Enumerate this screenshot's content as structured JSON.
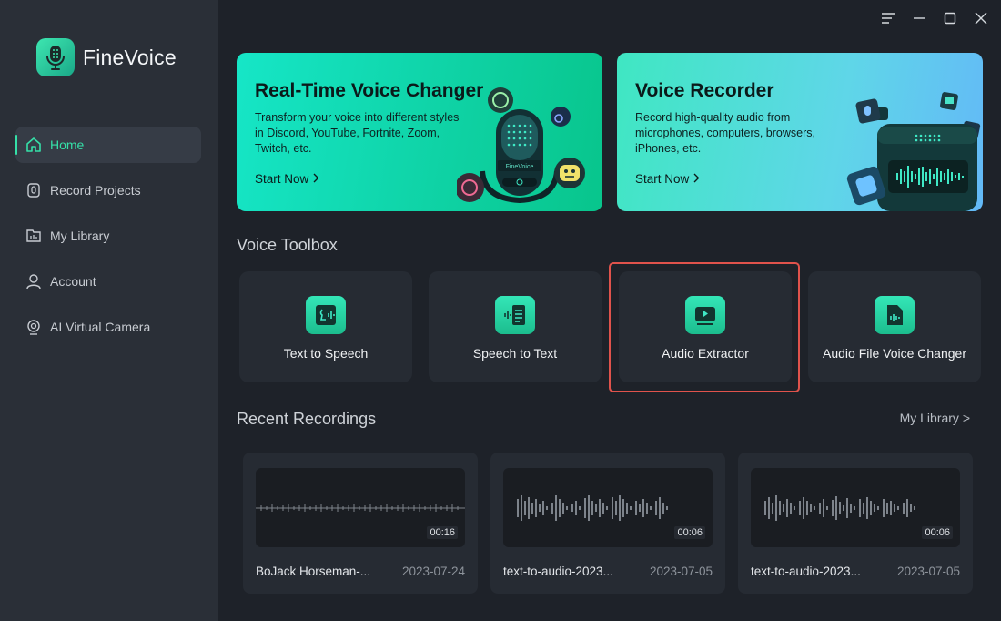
{
  "app": {
    "name": "FineVoice"
  },
  "sidebar": {
    "items": [
      {
        "label": "Home",
        "icon": "home-icon",
        "active": true
      },
      {
        "label": "Record Projects",
        "icon": "record-projects-icon"
      },
      {
        "label": "My Library",
        "icon": "library-icon"
      },
      {
        "label": "Account",
        "icon": "account-icon"
      },
      {
        "label": "AI Virtual Camera",
        "icon": "camera-icon"
      }
    ]
  },
  "window_controls": [
    "menu-icon",
    "minimize-icon",
    "maximize-icon",
    "close-icon"
  ],
  "banners": [
    {
      "title": "Real-Time Voice Changer",
      "description": "Transform your voice into different styles in Discord, YouTube, Fortnite, Zoom, Twitch, etc.",
      "cta": "Start Now",
      "art_label": "FineVoice"
    },
    {
      "title": "Voice Recorder",
      "description": "Record high-quality audio from microphones, computers, browsers, iPhones, etc.",
      "cta": "Start Now"
    }
  ],
  "toolbox": {
    "title": "Voice Toolbox",
    "tools": [
      {
        "label": "Text to Speech",
        "icon": "text-to-speech-icon"
      },
      {
        "label": "Speech to Text",
        "icon": "speech-to-text-icon"
      },
      {
        "label": "Audio Extractor",
        "icon": "audio-extractor-icon",
        "highlighted": true
      },
      {
        "label": "Audio File Voice Changer",
        "icon": "audio-file-voice-changer-icon"
      }
    ]
  },
  "recent": {
    "title": "Recent Recordings",
    "library_link": "My Library >",
    "items": [
      {
        "name": "BoJack Horseman-...",
        "date": "2023-07-24",
        "duration": "00:16"
      },
      {
        "name": "text-to-audio-2023...",
        "date": "2023-07-05",
        "duration": "00:06"
      },
      {
        "name": "text-to-audio-2023...",
        "date": "2023-07-05",
        "duration": "00:06"
      }
    ]
  },
  "colors": {
    "accent": "#35e0a8",
    "highlight": "#e0534c",
    "sidebar_bg": "#2a2f37",
    "main_bg": "#1e2229"
  }
}
